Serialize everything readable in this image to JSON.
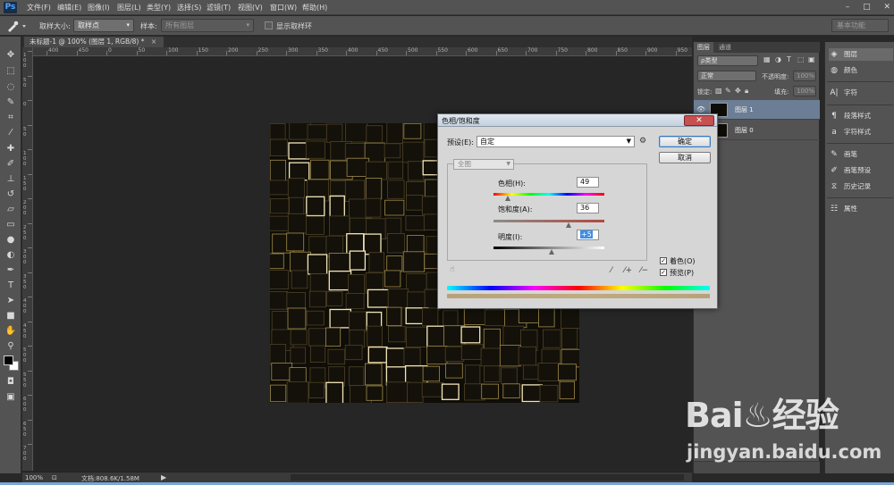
{
  "app": {
    "logo": "Ps"
  },
  "menubar": {
    "items": [
      "文件(F)",
      "编辑(E)",
      "图像(I)",
      "图层(L)",
      "类型(Y)",
      "选择(S)",
      "滤镜(T)",
      "视图(V)",
      "窗口(W)",
      "帮助(H)"
    ],
    "window_controls": [
      "–",
      "□",
      "✕"
    ]
  },
  "options_bar": {
    "tool_icon": "eyedropper-icon",
    "sample_size_label": "取样大小:",
    "sample_size_value": "取样点",
    "sample_label": "样本:",
    "sample_value": "所有图层",
    "show_ring_label": "显示取样环",
    "workspace_value": "基本功能"
  },
  "document": {
    "tab_title": "未标题-1 @ 100% (图层 1, RGB/8) *",
    "tab_close": "×",
    "ruler_h_labels": [
      "400",
      "450",
      "0",
      "50",
      "100",
      "150",
      "200",
      "250",
      "300",
      "350",
      "400",
      "450",
      "500",
      "550",
      "600",
      "650",
      "700",
      "750",
      "800",
      "850",
      "900",
      "950"
    ],
    "ruler_v_labels": [
      "100",
      "50",
      "0",
      "50",
      "100",
      "150",
      "200",
      "250",
      "300",
      "350",
      "400",
      "450",
      "500",
      "550",
      "600",
      "650",
      "700"
    ]
  },
  "status_bar": {
    "zoom": "100%",
    "doc_info": "文档:808.6K/1.58M",
    "arrow": "▶"
  },
  "layers_panel": {
    "tabs": [
      "图层",
      "通道"
    ],
    "filter_value": "ρ类型",
    "blend_mode": "正常",
    "opacity_label": "不透明度:",
    "opacity_value": "100%",
    "lock_label": "锁定:",
    "fill_label": "填充:",
    "fill_value": "100%",
    "layers": [
      {
        "name": "图层 1",
        "selected": true,
        "visible": true
      },
      {
        "name": "图层 0",
        "selected": false,
        "visible": false
      }
    ]
  },
  "right_dock": {
    "items": [
      {
        "label": "图层",
        "icon": "layers-icon"
      },
      {
        "label": "颜色",
        "icon": "color-icon"
      },
      {
        "label": "字符",
        "icon": "character-icon"
      },
      {
        "label": "段落样式",
        "icon": "paragraph-styles-icon"
      },
      {
        "label": "字符样式",
        "icon": "character-styles-icon"
      },
      {
        "label": "画笔",
        "icon": "brush-icon"
      },
      {
        "label": "画笔预设",
        "icon": "brush-presets-icon"
      },
      {
        "label": "历史记录",
        "icon": "history-icon"
      },
      {
        "label": "属性",
        "icon": "properties-icon"
      }
    ]
  },
  "dialog": {
    "title": "色相/饱和度",
    "close": "✕",
    "preset_label": "预设(E):",
    "preset_value": "自定",
    "ok_button": "确定",
    "cancel_button": "取消",
    "channel_value": "全图",
    "hue_label": "色相(H):",
    "hue_value": "49",
    "saturation_label": "饱和度(A):",
    "saturation_value": "36",
    "lightness_label": "明度(I):",
    "lightness_value": "+5",
    "colorize_label": "着色(O)",
    "colorize_checked": true,
    "preview_label": "预览(P)",
    "preview_checked": true,
    "check_mark": "✓",
    "hue_fraction": 0.136,
    "saturation_fraction": 0.68,
    "lightness_fraction": 0.525
  },
  "watermark": {
    "brand": "Bai♨经验",
    "url": "jingyan.baidu.com"
  }
}
